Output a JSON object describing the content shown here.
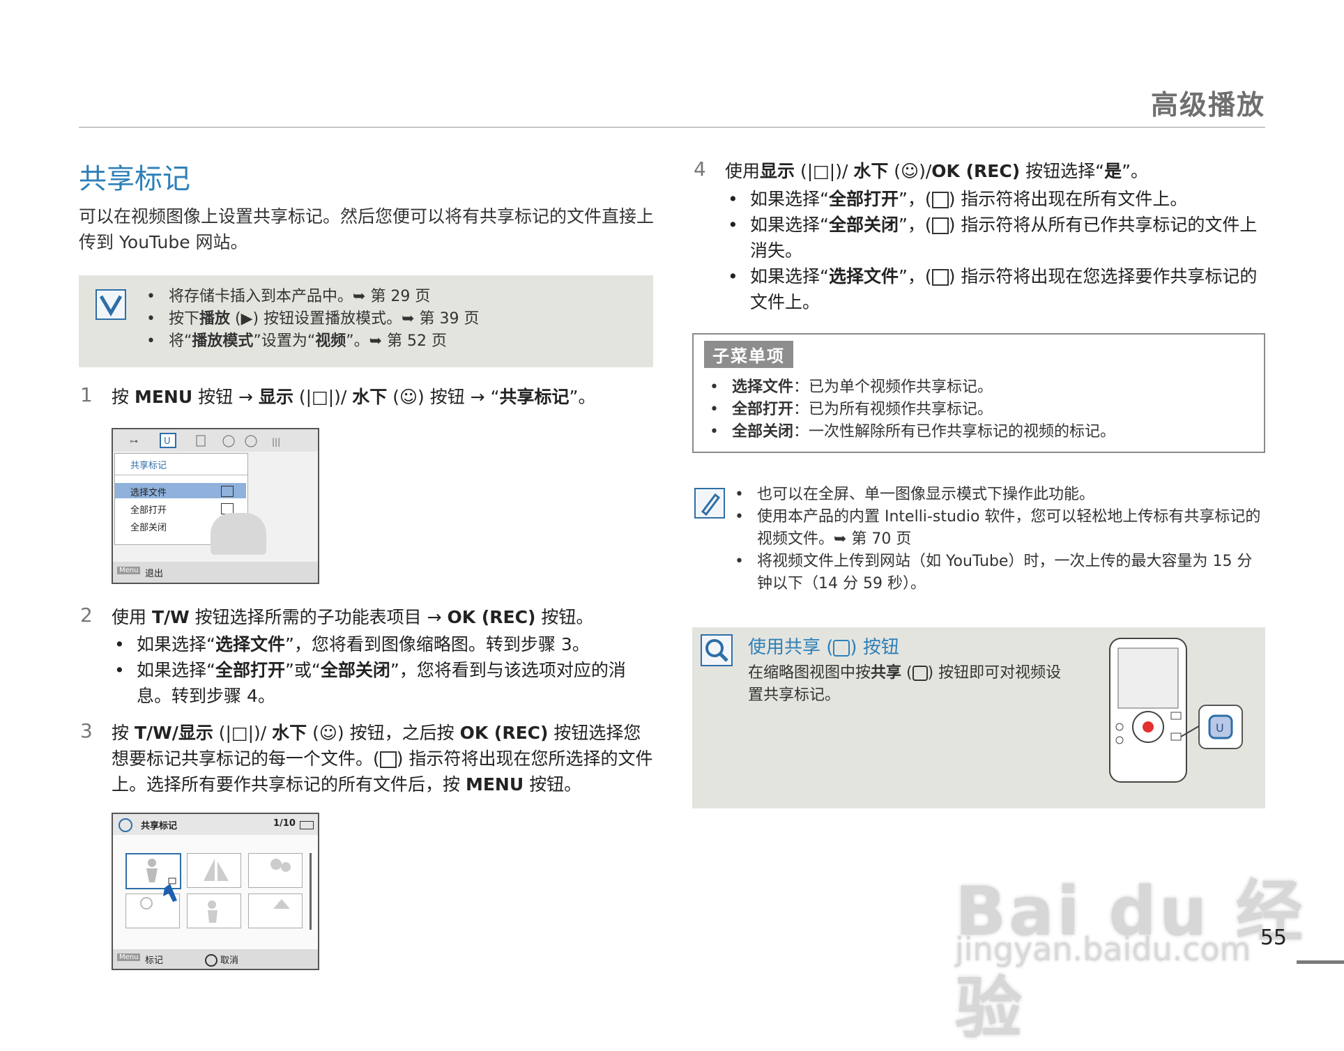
{
  "header": {
    "section": "高级播放",
    "page_number": "55"
  },
  "title": "共享标记",
  "intro": "可以在视频图像上设置共享标记。然后您便可以将有共享标记的文件直接上传到 YouTube 网站。",
  "prep": [
    {
      "a": "将存储卡插入到本产品中。",
      "b": "",
      "c": "",
      "d": "",
      "e": "",
      "ref": "➥ 第 29 页"
    },
    {
      "a": "按下",
      "b": "播放",
      "c": " (▶) 按钮设置播放模式。",
      "d": "",
      "e": "",
      "ref": "➥ 第 39 页"
    },
    {
      "a": "将“",
      "b": "播放模式",
      "c": "”设置为“",
      "d": "视频",
      "e": "”。",
      "ref": "➥ 第 52 页"
    }
  ],
  "step1": {
    "num": "1",
    "t1": "按 ",
    "b1": "MENU",
    "t2": " 按钮 → ",
    "b2": "显示",
    "t3": " (|□|)/ ",
    "b3": "水下",
    "t4": " (☺) 按钮 → “",
    "b4": "共享标记",
    "t5": "”。"
  },
  "lcd1": {
    "menu_title": "共享标记",
    "items": [
      "选择文件",
      "全部打开",
      "全部关闭"
    ],
    "footer_btn": "Menu",
    "footer_label": "退出"
  },
  "step2": {
    "num": "2",
    "t1": "使用 ",
    "b1": "T/W",
    "t2": " 按钮选择所需的子功能表项目 → ",
    "b2": "OK (REC)",
    "t3": " 按钮。",
    "bullets": [
      {
        "a": "如果选择“",
        "b": "选择文件",
        "c": "”，您将看到图像缩略图。转到步骤 3。",
        "d": "",
        "e": ""
      },
      {
        "a": "如果选择“",
        "b": "全部打开",
        "c": "”或“",
        "d": "全部关闭",
        "e": "”，您将看到与该选项对应的消息。转到步骤 4。"
      }
    ]
  },
  "step3": {
    "num": "3",
    "t1": "按 ",
    "b1": "T/W/",
    "b2": "显示",
    "t2": " (|□|)/ ",
    "b3": "水下",
    "t3": " (☺) 按钮，之后按 ",
    "b4": "OK (REC)",
    "t4": " 按钮选择您想要标记共享标记的每一个文件。(",
    "t5": ") 指示符将出现在您所选择的文件上。选择所有要作共享标记的所有文件后，按 ",
    "b5": "MENU",
    "t6": " 按钮。"
  },
  "lcd2": {
    "title": "共享标记",
    "counter": "1/10",
    "footer_btn1": "Menu",
    "footer_label1": "标记",
    "footer_label2": "取消"
  },
  "step4": {
    "num": "4",
    "t1": "使用",
    "b1": "显示",
    "t2": " (|□|)/ ",
    "b2": "水下",
    "t3": " (☺)/",
    "b3": "OK (REC)",
    "t4": " 按钮选择“",
    "b4": "是",
    "t5": "”。",
    "bullets": [
      {
        "a": "如果选择“",
        "b": "全部打开",
        "c": "”，(",
        "d": ") 指示符将出现在所有文件上。"
      },
      {
        "a": "如果选择“",
        "b": "全部关闭",
        "c": "”，(",
        "d": ") 指示符将从所有已作共享标记的文件上消失。"
      },
      {
        "a": "如果选择“",
        "b": "选择文件",
        "c": "”，(",
        "d": ") 指示符将出现在您选择要作共享标记的文件上。"
      }
    ]
  },
  "submenu": {
    "tag": "子菜单项",
    "items": [
      {
        "k": "选择文件",
        "v": "：已为单个视频作共享标记。"
      },
      {
        "k": "全部打开",
        "v": "：已为所有视频作共享标记。"
      },
      {
        "k": "全部关闭",
        "v": "：一次性解除所有已作共享标记的视频的标记。"
      }
    ]
  },
  "notes": [
    "也可以在全屏、单一图像显示模式下操作此功能。",
    "使用本产品的内置 Intelli-studio 软件，您可以轻松地上传标有共享标记的视频文件。➥ 第 70 页",
    "将视频文件上传到网站（如 YouTube）时，一次上传的最大容量为 15 分钟以下（14 分 59 秒）。"
  ],
  "tip": {
    "title_a": "使用共享 (",
    "title_b": ") 按钮",
    "body_a": "在缩略图视图中按",
    "body_b": "共享",
    "body_c": " (",
    "body_d": ") 按钮即可对视频设置共享标记。"
  },
  "watermark": {
    "line1": "Bai du 经验",
    "line2": "jingyan.baidu.com"
  },
  "colors": {
    "accent_blue": "#2e80b8",
    "gray_box": "#e4e4df",
    "icon_blue": "#2e6ea7"
  }
}
